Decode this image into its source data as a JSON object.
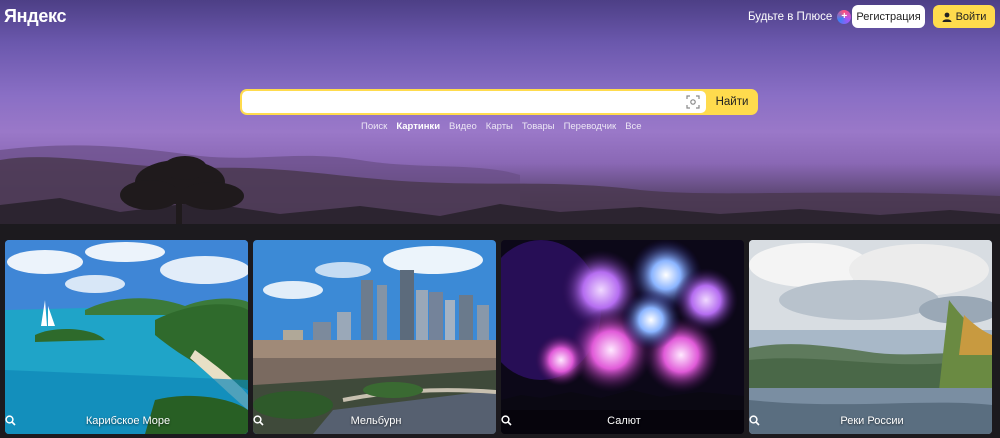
{
  "header": {
    "logo": "Яндекс",
    "plus_link": "Будьте в Плюсе",
    "register_label": "Регистрация",
    "login_label": "Войти"
  },
  "search": {
    "value": "",
    "placeholder": "",
    "button_label": "Найти"
  },
  "services": [
    "Поиск",
    "Картинки",
    "Видео",
    "Карты",
    "Товары",
    "Переводчик",
    "Все"
  ],
  "active_service": "Картинки",
  "cards": [
    {
      "label": "Карибское Море"
    },
    {
      "label": "Мельбурн"
    },
    {
      "label": "Салют"
    },
    {
      "label": "Реки России"
    }
  ],
  "colors": {
    "accent_yellow": "#ffdb4d",
    "page_bg": "#1c1a1e"
  }
}
